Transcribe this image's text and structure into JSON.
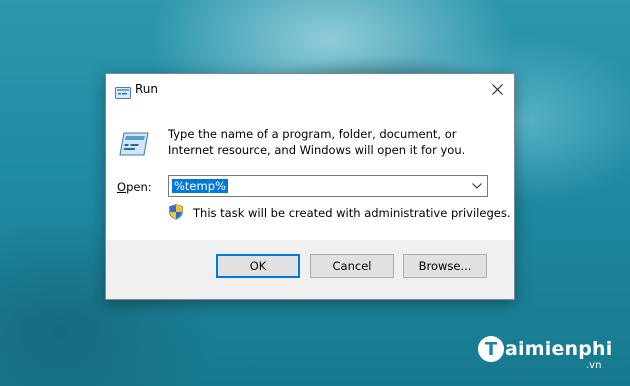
{
  "dialog": {
    "title": "Run",
    "description": "Type the name of a program, folder, document, or Internet resource, and Windows will open it for you.",
    "open_label_accel": "O",
    "open_label_rest": "pen:",
    "open_value": "%temp%",
    "admin_note": "This task will be created with administrative privileges.",
    "buttons": {
      "ok": "OK",
      "cancel": "Cancel",
      "browse": "Browse..."
    },
    "icons": {
      "title": "run-icon",
      "main": "run-icon",
      "close": "close-icon",
      "dropdown": "chevron-down-icon",
      "shield": "uac-shield-icon"
    }
  },
  "watermark": {
    "letter": "T",
    "text": "aimienphi",
    "sub": ".vn"
  }
}
